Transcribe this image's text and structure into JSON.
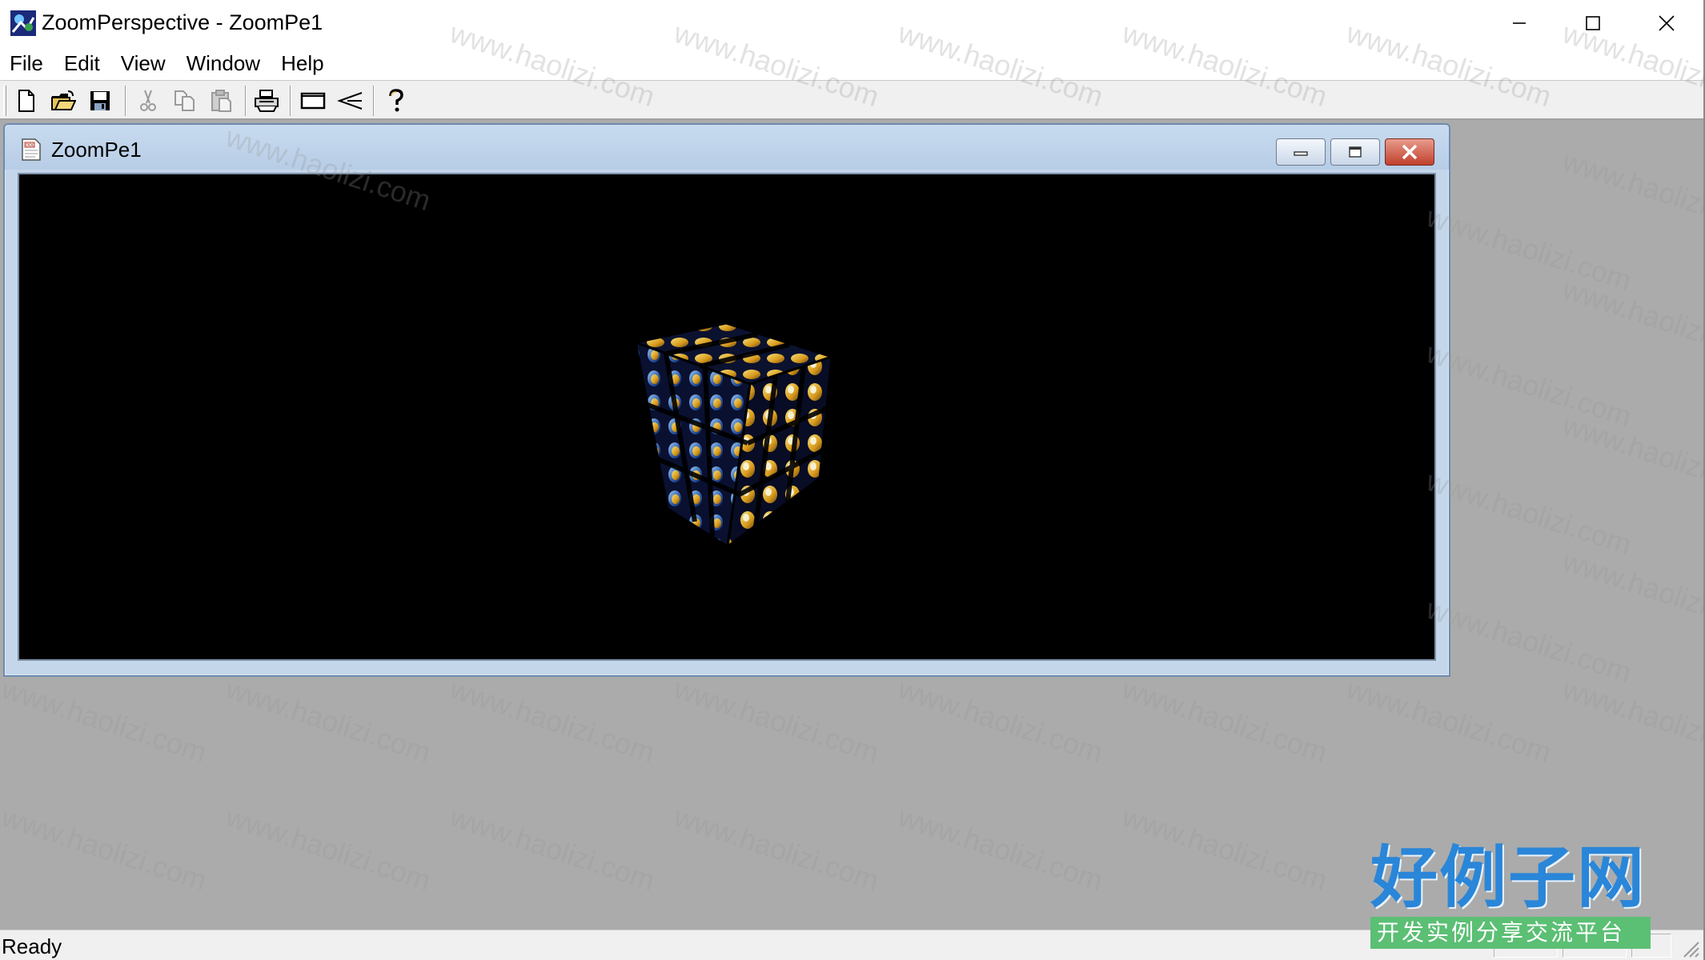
{
  "window": {
    "title": "ZoomPerspective - ZoomPe1",
    "controls": {
      "minimize_icon": "minimize-icon",
      "maximize_icon": "maximize-icon",
      "close_icon": "close-icon"
    }
  },
  "menu": {
    "items": [
      {
        "label": "File"
      },
      {
        "label": "Edit"
      },
      {
        "label": "View"
      },
      {
        "label": "Window"
      },
      {
        "label": "Help"
      }
    ]
  },
  "toolbar": {
    "buttons": [
      {
        "icon": "new-document-icon",
        "enabled": true
      },
      {
        "icon": "open-folder-icon",
        "enabled": true
      },
      {
        "icon": "save-icon",
        "enabled": true
      },
      {
        "icon": "cut-icon",
        "enabled": false
      },
      {
        "icon": "copy-icon",
        "enabled": false
      },
      {
        "icon": "paste-icon",
        "enabled": false
      },
      {
        "icon": "print-icon",
        "enabled": true
      },
      {
        "icon": "rectangle-zoom-icon",
        "enabled": true
      },
      {
        "icon": "perspective-icon",
        "enabled": true
      },
      {
        "icon": "help-icon",
        "enabled": true
      }
    ]
  },
  "child_window": {
    "title": "ZoomPe1",
    "icon": "document-icon",
    "content": "textured-cube-3d-view"
  },
  "status": {
    "text": "Ready"
  },
  "watermark": {
    "text": "www.haolizi.com",
    "brand_main": "好例子网",
    "brand_sub": "开发实例分享交流平台"
  },
  "colors": {
    "mdi_background": "#ababab",
    "viewport_background": "#000000",
    "child_frame": "#c4d6ea",
    "brand_blue": "#2a86d8",
    "brand_green": "#5bbf74"
  }
}
